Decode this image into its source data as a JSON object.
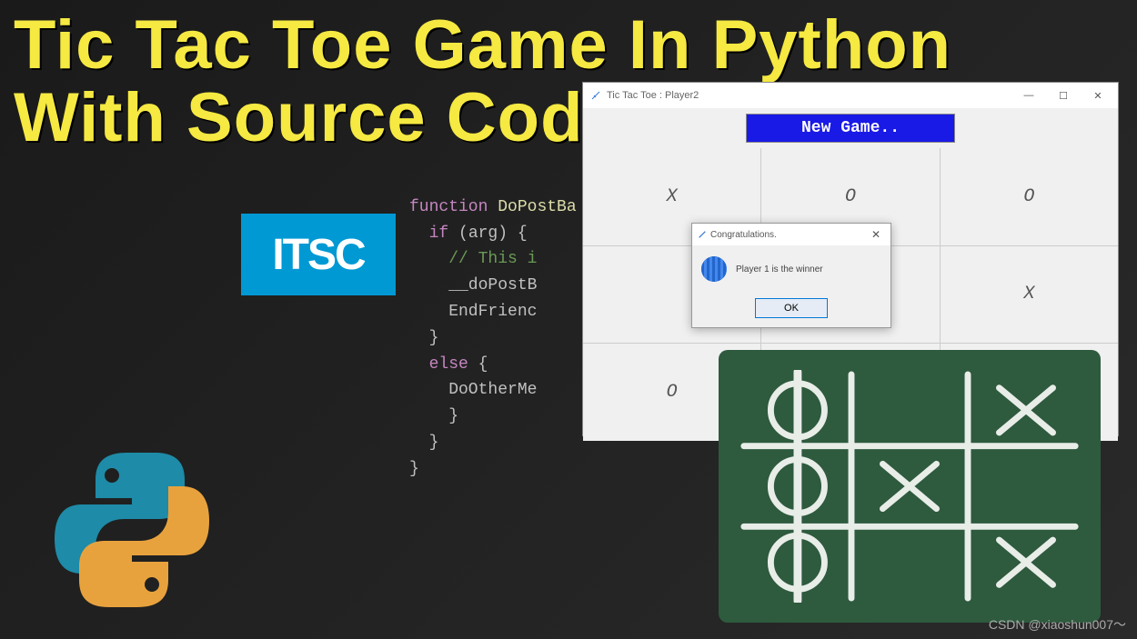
{
  "title_line1": "Tic Tac Toe Game In Python",
  "title_line2": "With Source Code",
  "logo_text": "ITSC",
  "code": {
    "l1_fn": "function",
    "l1_name": "DoPostBa",
    "l2_if": "if",
    "l2_cond": " (arg) {",
    "l3_comment": "    // This i",
    "l4": "    __doPostB",
    "l5": "    EndFrienc",
    "l6": "  }",
    "l7_else": "  else",
    "l7_brace": " {",
    "l8": "    DoOtherMe",
    "l9": "    }",
    "l10": "  }",
    "l11": "}"
  },
  "game_window": {
    "title": "Tic Tac Toe : Player2",
    "minimize": "—",
    "maximize": "☐",
    "close": "✕",
    "new_game_label": "New Game..",
    "cells": [
      "X",
      "O",
      "O",
      "",
      "",
      "X",
      "O",
      "",
      ""
    ]
  },
  "dialog": {
    "title": "Congratulations.",
    "close": "✕",
    "message": "Player 1 is the winner",
    "ok_label": "OK"
  },
  "watermark": "CSDN @xiaoshun007～"
}
